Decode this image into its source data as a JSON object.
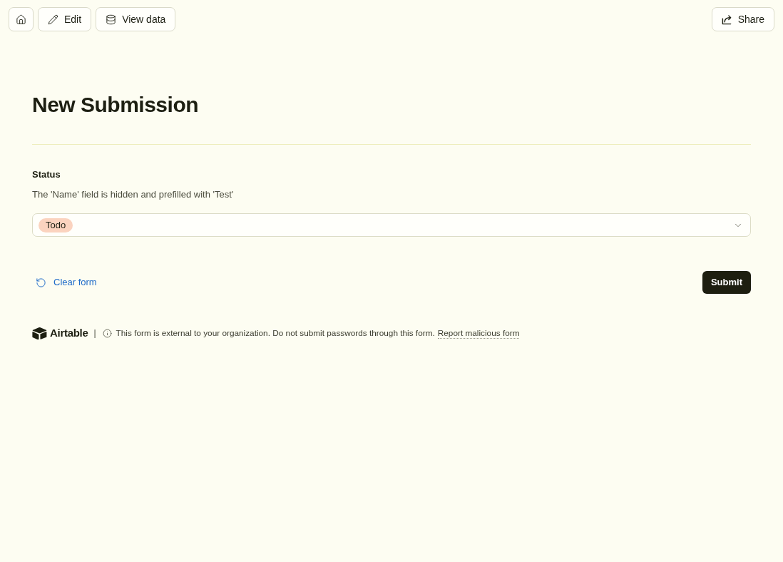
{
  "toolbar": {
    "left": [
      {
        "kind": "home"
      },
      {
        "kind": "edit",
        "label": "Edit"
      },
      {
        "kind": "data",
        "label": "View data"
      }
    ],
    "right": [
      {
        "kind": "share",
        "label": "Share"
      }
    ]
  },
  "form": {
    "title": "New Submission",
    "fields": [
      {
        "kind": "select",
        "label": "Status",
        "description": "The 'Name' field is hidden and prefilled with 'Test'",
        "value": {
          "label": "Todo",
          "color": "#fbd3bf"
        }
      }
    ]
  },
  "actions": {
    "clear": "Clear form",
    "submit": "Submit"
  },
  "footer": {
    "brand": "Airtable",
    "separator": "|",
    "notice": "This form is external to your organization. Do not submit passwords through this form.",
    "link": "Report malicious form"
  }
}
